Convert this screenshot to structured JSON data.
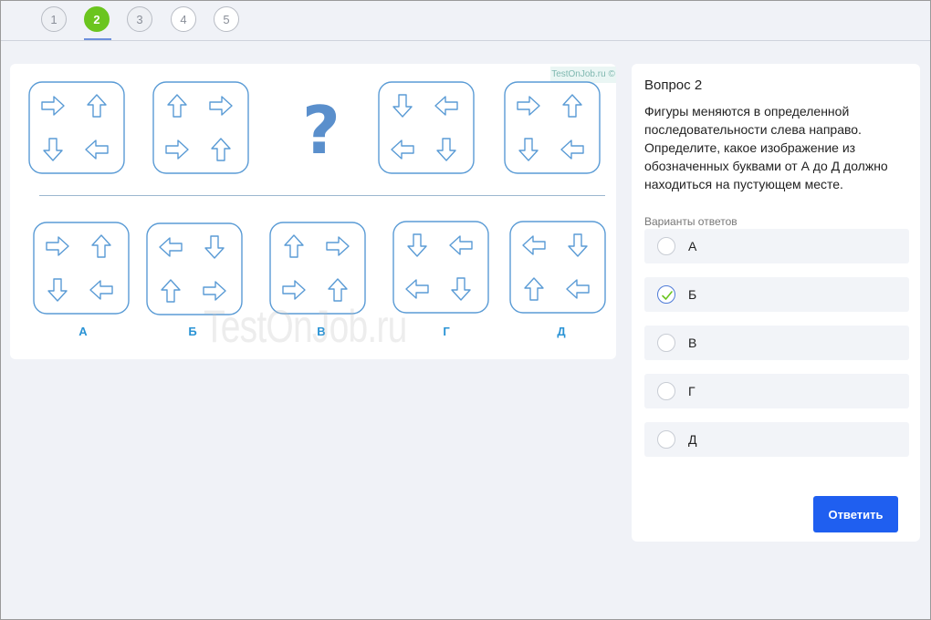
{
  "stepper": {
    "steps": [
      "1",
      "2",
      "3",
      "4",
      "5"
    ],
    "current": "2"
  },
  "watermark": {
    "small": "TestOnJob.ru ©",
    "large": "TestOnJob.ru"
  },
  "puzzle": {
    "question_mark": "?",
    "sequence": [
      {
        "arrows": [
          "right",
          "up",
          "down",
          "left"
        ]
      },
      {
        "arrows": [
          "up",
          "right",
          "right",
          "up"
        ]
      },
      {
        "missing": true
      },
      {
        "arrows": [
          "down",
          "left",
          "left",
          "down"
        ]
      },
      {
        "arrows": [
          "right",
          "up",
          "down",
          "left"
        ]
      }
    ],
    "options": [
      {
        "letter": "А",
        "arrows": [
          "right",
          "up",
          "down",
          "left"
        ]
      },
      {
        "letter": "Б",
        "arrows": [
          "left",
          "down",
          "up",
          "right"
        ]
      },
      {
        "letter": "В",
        "arrows": [
          "up",
          "right",
          "right",
          "up"
        ]
      },
      {
        "letter": "Г",
        "arrows": [
          "down",
          "left",
          "left",
          "down"
        ]
      },
      {
        "letter": "Д",
        "arrows": [
          "left",
          "down",
          "up",
          "left"
        ]
      }
    ]
  },
  "question": {
    "title": "Вопрос 2",
    "text": "Фигуры меняются в определенной последовательности слева направо. Определите, какое изображение из обозначенных буквами от А до Д должно находиться на пустующем месте.",
    "options_label": "Варианты ответов",
    "options": [
      {
        "label": "А",
        "checked": false
      },
      {
        "label": "Б",
        "checked": true
      },
      {
        "label": "В",
        "checked": false
      },
      {
        "label": "Г",
        "checked": false
      },
      {
        "label": "Д",
        "checked": false
      }
    ],
    "submit_label": "Ответить"
  },
  "colors": {
    "active_step": "#6bc51f",
    "figure_stroke": "#5a9bd5",
    "option_letter": "#2a93d5",
    "submit": "#1f5ff0",
    "radio_check": "#6bc51f"
  },
  "icons": {
    "figure_arrow": "outlined-arrow-icon",
    "radio_check": "checkmark-icon"
  }
}
